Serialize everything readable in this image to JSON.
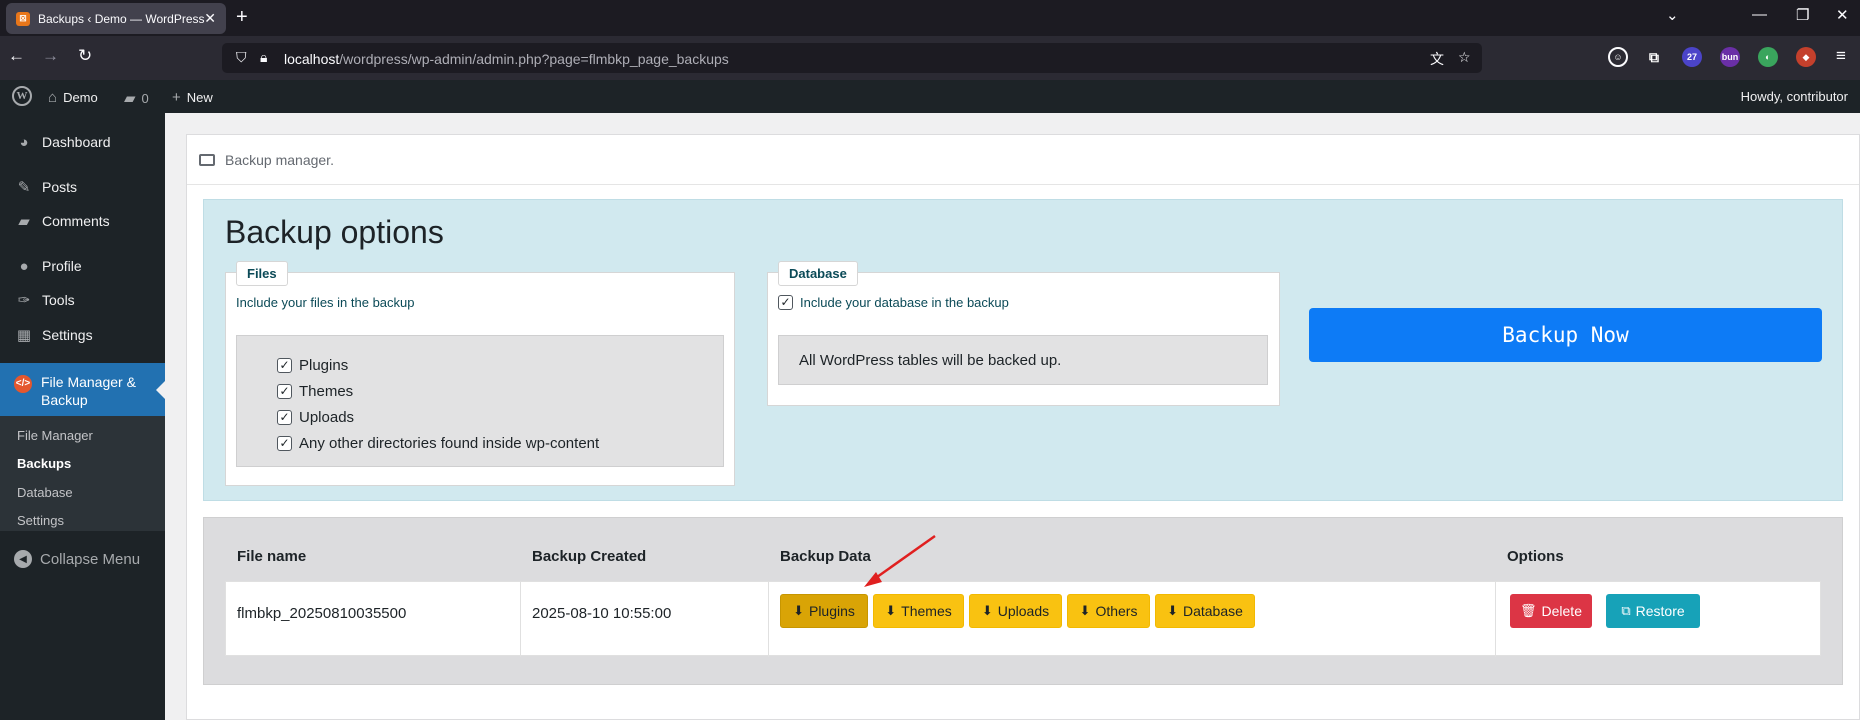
{
  "browser": {
    "tab_title": "Backups ‹ Demo — WordPress",
    "url_host": "localhost",
    "url_path": "/wordpress/wp-admin/admin.php?page=flmbkp_page_backups",
    "ext_badge_count": "27",
    "ext_badge_text": "bun"
  },
  "adminbar": {
    "site_name": "Demo",
    "comments_count": "0",
    "new_label": "New",
    "howdy": "Howdy, contributor"
  },
  "sidebar": {
    "items": [
      {
        "label": "Dashboard",
        "icon": "dashboard-icon"
      },
      {
        "label": "Posts",
        "icon": "pin-icon"
      },
      {
        "label": "Comments",
        "icon": "comment-icon"
      },
      {
        "label": "Profile",
        "icon": "user-icon"
      },
      {
        "label": "Tools",
        "icon": "wrench-icon"
      },
      {
        "label": "Settings",
        "icon": "settings-icon"
      }
    ],
    "active": "File Manager & Backup",
    "submenu": [
      "File Manager",
      "Backups",
      "Database",
      "Settings"
    ],
    "collapse": "Collapse Menu"
  },
  "panel": {
    "header": "Backup manager."
  },
  "options": {
    "title": "Backup options",
    "files": {
      "legend": "Files",
      "desc": "Include your files in the backup",
      "items": [
        "Plugins",
        "Themes",
        "Uploads",
        "Any other directories found inside wp-content"
      ]
    },
    "database": {
      "legend": "Database",
      "desc": "Include your database in the backup",
      "note": "All WordPress tables will be backed up."
    },
    "backup_now": "Backup Now"
  },
  "table": {
    "headers": [
      "File name",
      "Backup Created",
      "Backup Data",
      "Options"
    ],
    "rows": [
      {
        "file_name": "flmbkp_20250810035500",
        "created": "2025-08-10 10:55:00",
        "data_buttons": [
          "Plugins",
          "Themes",
          "Uploads",
          "Others",
          "Database"
        ],
        "delete": "Delete",
        "restore": "Restore"
      }
    ]
  },
  "colors": {
    "admin_dark": "#1d2327",
    "active_blue": "#2271b1",
    "backup_blue": "#0d7bf6",
    "warning": "#f9c211",
    "danger": "#dc3545",
    "info": "#17a2b8"
  }
}
